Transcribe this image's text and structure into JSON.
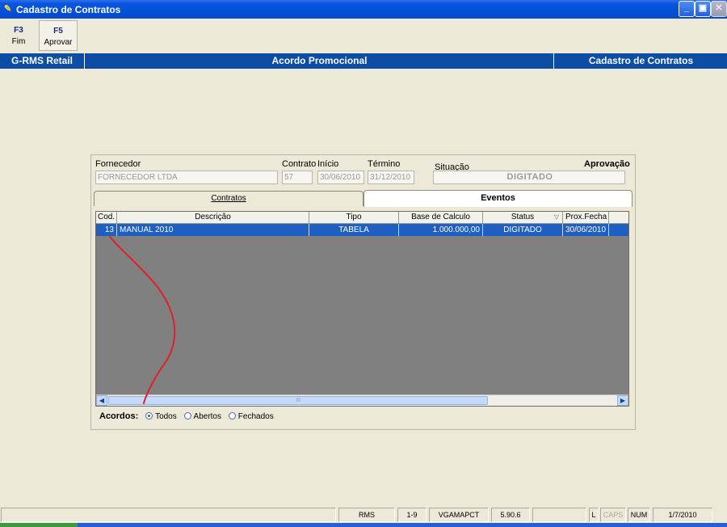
{
  "window": {
    "title": "Cadastro de Contratos"
  },
  "toolbar": {
    "f3": {
      "key": "F3",
      "label": "Fim"
    },
    "f5": {
      "key": "F5",
      "label": "Aprovar"
    }
  },
  "infobar": {
    "left": "G-RMS Retail",
    "center": "Acordo Promocional",
    "right": "Cadastro de Contratos"
  },
  "form": {
    "fornecedor_label": "Fornecedor",
    "fornecedor_value": "FORNECEDOR LTDA",
    "contrato_label": "Contrato",
    "contrato_value": "57",
    "inicio_label": "Início",
    "inicio_value": "30/06/2010",
    "termino_label": "Término",
    "termino_value": "31/12/2010",
    "situacao_label": "Situação",
    "aprovacao_label": "Aprovação",
    "situacao_value": "DIGITADO"
  },
  "tabs": {
    "contratos": "Contratos",
    "eventos": "Eventos"
  },
  "grid": {
    "columns": [
      "Cod.",
      "Descrição",
      "Tipo",
      "Base de Calculo",
      "Status",
      "Prox.Fecha"
    ],
    "rows": [
      {
        "cod": "13",
        "descricao": "MANUAL 2010",
        "tipo": "TABELA",
        "base": "1.000.000,00",
        "status": "DIGITADO",
        "prox": "30/06/2010"
      }
    ],
    "scroll_thumb_label": "III"
  },
  "acordos": {
    "label": "Acordos:",
    "options": [
      "Todos",
      "Abertos",
      "Fechados"
    ],
    "selected": "Todos"
  },
  "statusbar": {
    "cells": [
      "RMS",
      "1-9",
      "VGAMAPCT",
      "5.90.6",
      "L",
      "CAPS",
      "NUM",
      "1/7/2010"
    ]
  },
  "colors": {
    "title_bar": "#0450d6",
    "info_bar": "#0c4da6",
    "selected_row": "#1d5fc2",
    "annotation": "#e0202a"
  }
}
